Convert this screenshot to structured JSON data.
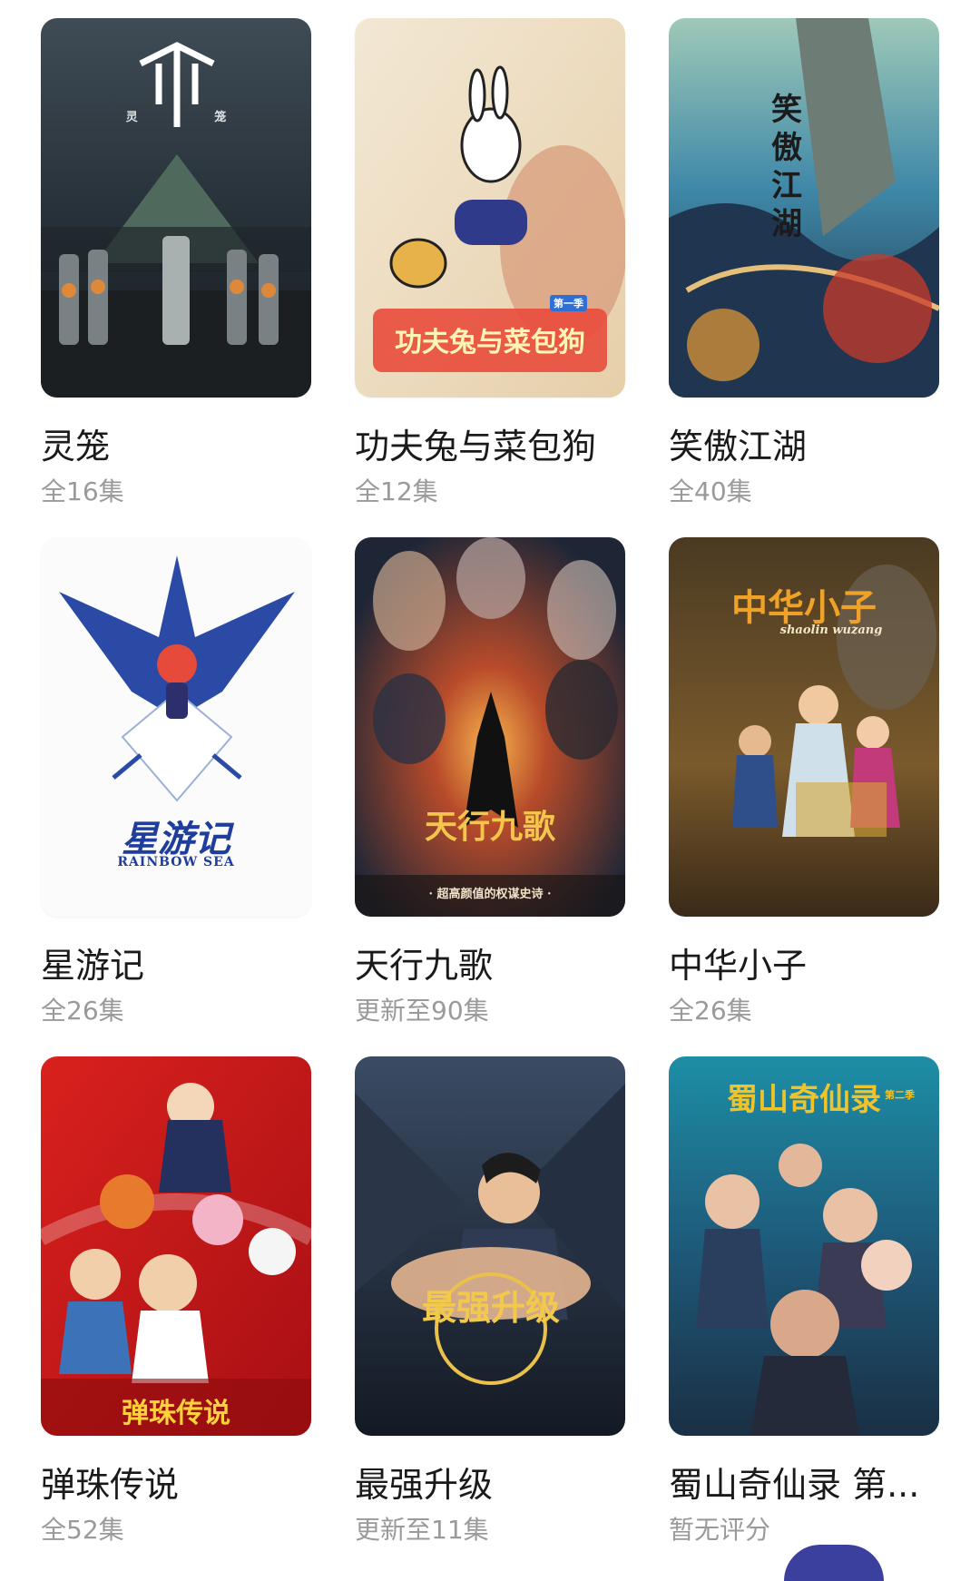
{
  "items": [
    {
      "title": "灵笼",
      "episodes": "全16集",
      "poster_text": "灵 笼",
      "poster_text2": "",
      "icon": "lingcage-poster"
    },
    {
      "title": "功夫兔与菜包狗",
      "episodes": "全12集",
      "poster_text": "功夫兔与菜包狗",
      "poster_text2": "第一季",
      "icon": "kungfu-rabbit-poster"
    },
    {
      "title": "笑傲江湖",
      "episodes": "全40集",
      "poster_text": "笑傲江湖",
      "poster_text2": "",
      "icon": "swordsman-poster"
    },
    {
      "title": "星游记",
      "episodes": "全26集",
      "poster_text": "星游记",
      "poster_text2": "RAINBOW SEA",
      "icon": "rainbow-sea-poster"
    },
    {
      "title": "天行九歌",
      "episodes": "更新至90集",
      "poster_text": "天行九歌",
      "poster_text2": "· 超高颜值的权谋史诗 ·",
      "icon": "tianxing-poster"
    },
    {
      "title": "中华小子",
      "episodes": "全26集",
      "poster_text": "中华小子",
      "poster_text2": "shaolin wuzang",
      "icon": "shaolin-poster"
    },
    {
      "title": "弹珠传说",
      "episodes": "全52集",
      "poster_text": "弹珠传说",
      "poster_text2": "",
      "icon": "marble-legend-poster"
    },
    {
      "title": "最强升级",
      "episodes": "更新至11集",
      "poster_text": "最强升级",
      "poster_text2": "",
      "icon": "strongest-upgrade-poster"
    },
    {
      "title": "蜀山奇仙录 第...",
      "episodes": "暂无评分",
      "poster_text": "蜀山奇仙录",
      "poster_text2": "第二季",
      "icon": "shushan-poster"
    }
  ],
  "colors": {
    "title": "#1a1a1a",
    "subtitle": "#9a9a9a",
    "fab": "#3b3f9e"
  }
}
